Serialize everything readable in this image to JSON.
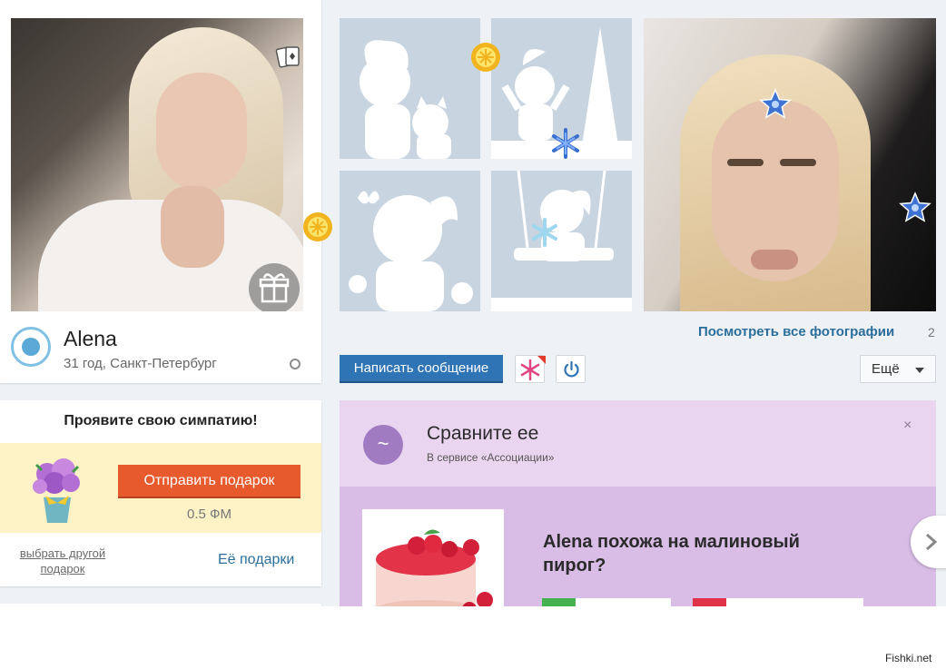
{
  "profile": {
    "name": "Alena",
    "meta": "31 год, Санкт-Петербург"
  },
  "photos": {
    "view_all": "Посмотреть все фотографии",
    "count": "2"
  },
  "actions": {
    "write_message": "Написать сообщение",
    "more": "Ещё"
  },
  "sympathy": {
    "title": "Проявите свою симпатию!",
    "send_gift": "Отправить подарок",
    "price": "0.5 ФМ",
    "choose_other": "выбрать другой подарок",
    "her_gifts": "Её подарки"
  },
  "associations": {
    "title": "Сравните ее",
    "subtitle": "В сервисе «Ассоциации»",
    "close": "×",
    "question": "Alena похожа на малиновый пирог?"
  },
  "watermark": "Fishki.net",
  "colors": {
    "primary_button": "#2f74b5",
    "gift_button": "#e65a2e",
    "link": "#2b6e9c",
    "assoc_bg": "#e9d6ef",
    "placeholder": "#c8d5e0"
  },
  "icons": [
    "cards-icon",
    "gift-icon",
    "sun-badge-icon",
    "star-badge-icon",
    "snowflake-icon",
    "power-icon",
    "chevron-down-icon",
    "close-icon",
    "chevron-right-icon",
    "tilde-icon"
  ]
}
